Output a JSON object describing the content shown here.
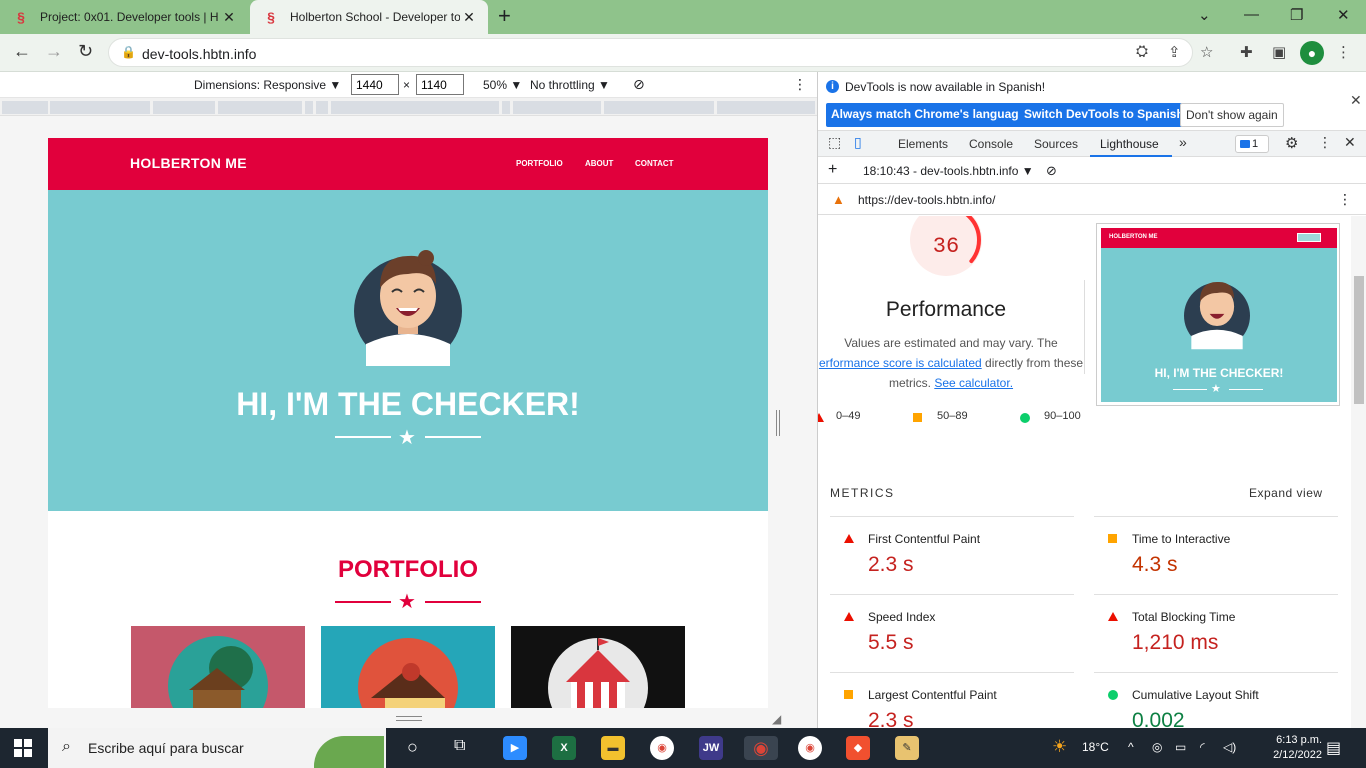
{
  "browser": {
    "tabs": [
      {
        "title": "Project: 0x01. Developer tools | H",
        "active": false
      },
      {
        "title": "Holberton School - Developer to",
        "active": true
      }
    ],
    "url": "dev-tools.hbtn.info"
  },
  "device_toolbar": {
    "dimensions_label": "Dimensions: Responsive ▼",
    "width": "1440",
    "times": "×",
    "height": "1140",
    "zoom": "50% ▼",
    "throttling": "No throttling ▼"
  },
  "site": {
    "brand": "HOLBERTON ME",
    "nav": [
      "PORTFOLIO",
      "ABOUT",
      "CONTACT"
    ],
    "hero_title": "HI, I'M THE CHECKER!",
    "portfolio_title": "PORTFOLIO",
    "colors": {
      "primary": "#e1003c",
      "hero": "#78cbd0"
    }
  },
  "devtools": {
    "info_text": "DevTools is now available in Spanish!",
    "info_buttons": [
      "Always match Chrome's language",
      "Switch DevTools to Spanish",
      "Don't show again"
    ],
    "tabs": [
      "Elements",
      "Console",
      "Sources",
      "Lighthouse"
    ],
    "active_tab": "Lighthouse",
    "more_tabs": "»",
    "issues_count": "1",
    "report_selector": "18:10:43 - dev-tools.hbtn.info ▼",
    "report_url": "https://dev-tools.hbtn.info/",
    "score": "36",
    "score_fraction": 0.36,
    "category": "Performance",
    "desc_1": "Values are estimated and may vary. The",
    "desc_link": "erformance score is calculated",
    "desc_2": " directly from these",
    "desc_3": "metrics. ",
    "desc_link2": "See calculator.",
    "legend": [
      "0–49",
      "50–89",
      "90–100"
    ],
    "metrics_header": "METRICS",
    "expand_view": "Expand view",
    "metrics": [
      {
        "label": "First Contentful Paint",
        "value": "2.3 s",
        "rating": "fail"
      },
      {
        "label": "Time to Interactive",
        "value": "4.3 s",
        "rating": "average"
      },
      {
        "label": "Speed Index",
        "value": "5.5 s",
        "rating": "fail"
      },
      {
        "label": "Total Blocking Time",
        "value": "1,210 ms",
        "rating": "fail"
      },
      {
        "label": "Largest Contentful Paint",
        "value": "2.3 s",
        "rating": "average"
      },
      {
        "label": "Cumulative Layout Shift",
        "value": "0.002",
        "rating": "pass"
      }
    ],
    "screenshot": {
      "brand": "HOLBERTON ME",
      "title": "HI, I'M THE CHECKER!"
    }
  },
  "taskbar": {
    "search_placeholder": "Escribe aquí para buscar",
    "weather": "18°C",
    "time": "6:13 p.m.",
    "date": "2/12/2022",
    "apps": [
      "task-view",
      "zoom",
      "excel",
      "file-explorer",
      "chrome",
      "jw",
      "chrome-active",
      "chrome-2",
      "git",
      "paint"
    ]
  }
}
